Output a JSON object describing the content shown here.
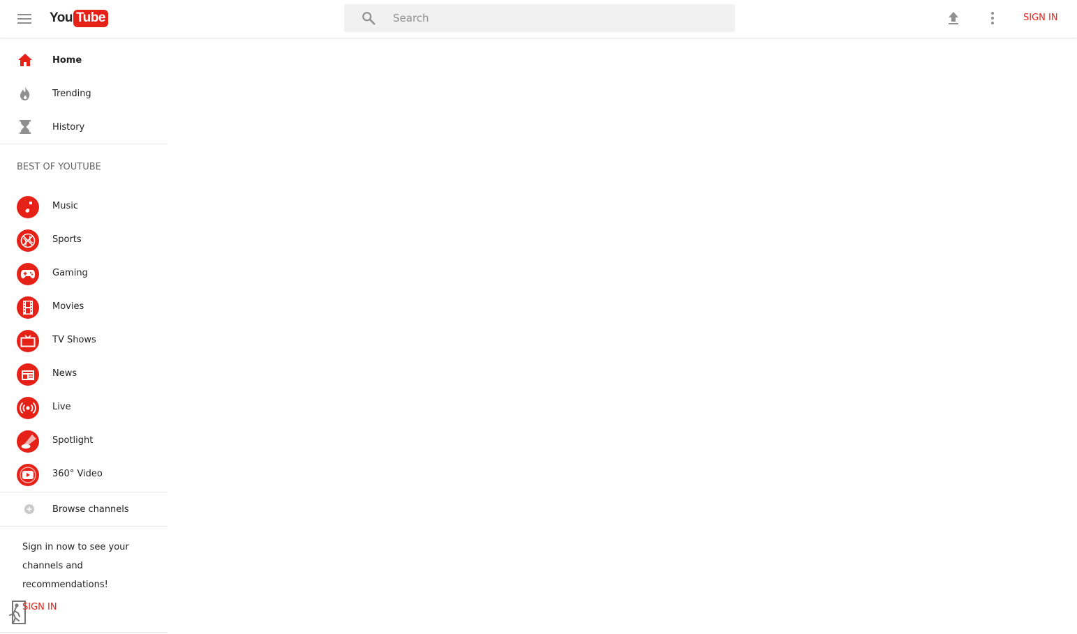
{
  "header": {
    "logo_you": "You",
    "logo_tube": "Tube",
    "search_placeholder": "Search",
    "search_value": "",
    "signin_label": "SIGN IN"
  },
  "sidebar": {
    "primary": [
      {
        "label": "Home",
        "icon": "home-icon",
        "active": true
      },
      {
        "label": "Trending",
        "icon": "flame-icon",
        "active": false
      },
      {
        "label": "History",
        "icon": "hourglass-icon",
        "active": false
      }
    ],
    "section_title": "BEST OF YOUTUBE",
    "categories": [
      {
        "label": "Music",
        "icon": "music-note-icon"
      },
      {
        "label": "Sports",
        "icon": "basketball-icon"
      },
      {
        "label": "Gaming",
        "icon": "gamepad-icon"
      },
      {
        "label": "Movies",
        "icon": "film-icon"
      },
      {
        "label": "TV Shows",
        "icon": "tv-icon"
      },
      {
        "label": "News",
        "icon": "newspaper-icon"
      },
      {
        "label": "Live",
        "icon": "broadcast-icon"
      },
      {
        "label": "Spotlight",
        "icon": "spotlight-icon"
      },
      {
        "label": "360° Video",
        "icon": "360-video-icon"
      }
    ],
    "browse_channels": "Browse channels",
    "signin_promo": "Sign in now to see your channels and recommendations!",
    "signin_label": "SIGN IN"
  },
  "colors": {
    "accent": "#e62117",
    "icon_gray": "#909090",
    "divider": "#e8e8e8"
  }
}
